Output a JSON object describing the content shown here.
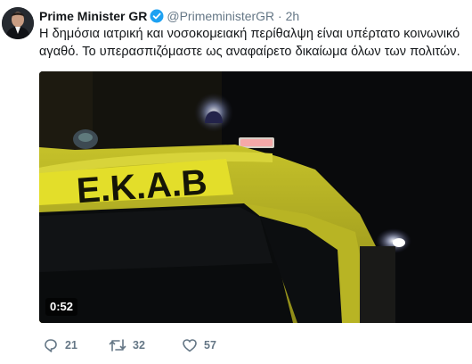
{
  "tweet": {
    "author_name": "Prime Minister GR",
    "handle": "@PrimeministerGR",
    "separator": "·",
    "time": "2h",
    "text": "Η δημόσια ιατρική και νοσοκομειακή περίθαλψη είναι υπέρτατο κοινωνικό αγαθό. Το υπερασπιζόμαστε ως αναφαίρετο δικαίωμα όλων των πολιτών.",
    "verified": true
  },
  "media": {
    "type": "video",
    "duration": "0:52",
    "sign_text": "Ε.Κ.Α.Β",
    "colors": {
      "vehicle_yellow": "#e3de2a",
      "background": "#0b0b0a",
      "light": "#ffffff"
    }
  },
  "actions": {
    "replies": "21",
    "retweets": "32",
    "likes": "57"
  },
  "icons": {
    "verified": "verified-badge-icon",
    "reply": "reply-icon",
    "retweet": "retweet-icon",
    "like": "heart-icon"
  },
  "colors": {
    "text": "#14171a",
    "secondary": "#657786",
    "verified_blue": "#1da1f2"
  }
}
